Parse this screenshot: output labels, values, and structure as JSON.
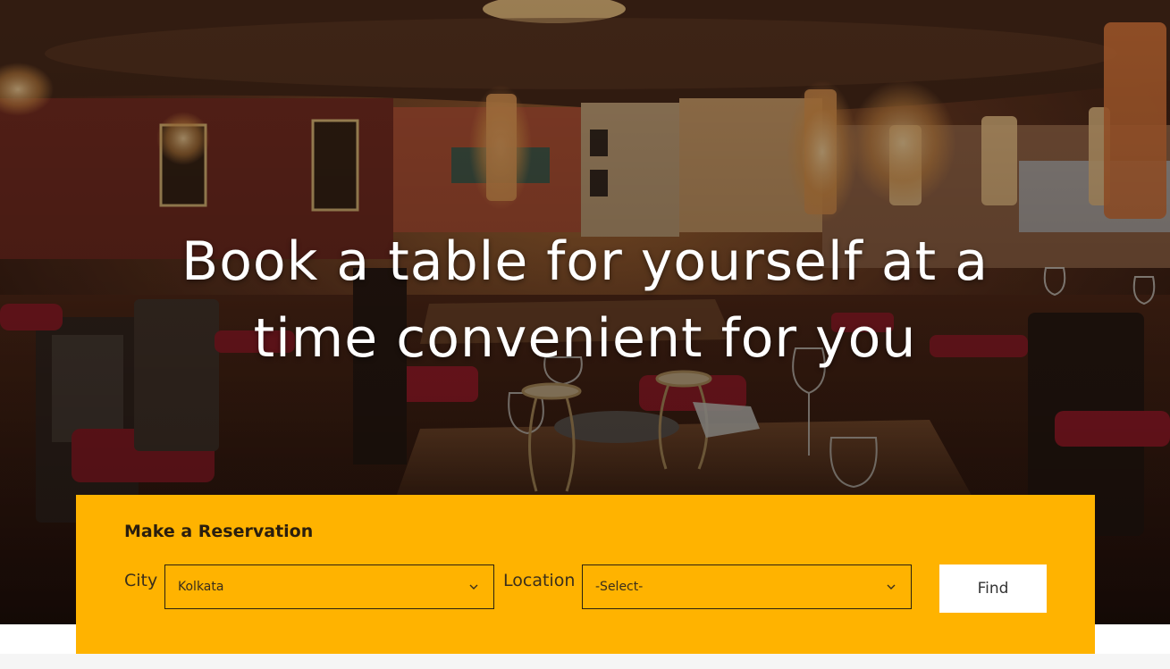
{
  "hero": {
    "title_line_1": "Book a table for yourself at a",
    "title_line_2": "time convenient for you"
  },
  "reservation": {
    "title": "Make a Reservation",
    "city_label": "City",
    "city_value": "Kolkata",
    "location_label": "Location",
    "location_value": "-Select-",
    "find_label": "Find"
  },
  "colors": {
    "panel_background": "#ffb300",
    "button_background": "#ffffff",
    "hero_text": "#ffffff"
  },
  "icons": {
    "city_dropdown": "chevron-down-icon",
    "location_dropdown": "chevron-down-icon"
  }
}
